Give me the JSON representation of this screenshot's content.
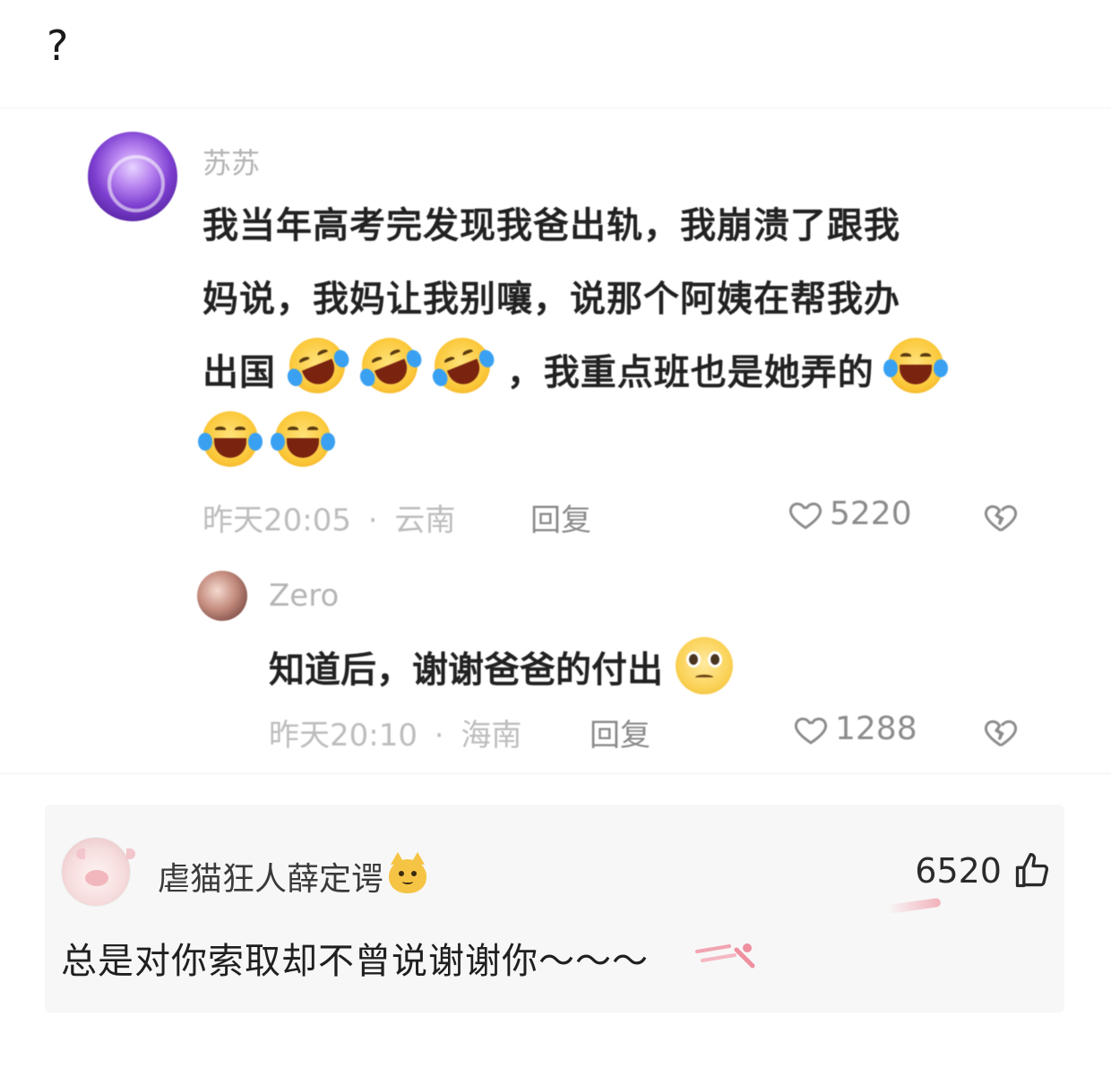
{
  "post": {
    "caption": "?"
  },
  "screenshot": {
    "comment1": {
      "username": "苏苏",
      "text_lines": [
        "我当年高考完发现我爸出轨，我崩溃了跟我",
        "妈说，我妈让我别嚷，说那个阿姨在帮我办",
        "出国",
        "，我重点班也是她弄的"
      ],
      "time": "昨天20:05",
      "separator": "·",
      "location": "云南",
      "reply_label": "回复",
      "likes": "5220",
      "emoji_icon": "laughing-tears-emoji"
    },
    "comment2": {
      "username": "Zero",
      "text": "知道后，谢谢爸爸的付出",
      "time": "昨天20:10",
      "separator": "·",
      "location": "海南",
      "reply_label": "回复",
      "likes": "1288",
      "emoji_icon": "pleading-face-emoji"
    }
  },
  "comment_card": {
    "username": "虐猫狂人薛定谔",
    "name_emoji": "cat-face-emoji",
    "likes": "6520",
    "text": "总是对你索取却不曾说谢谢你～～～"
  }
}
